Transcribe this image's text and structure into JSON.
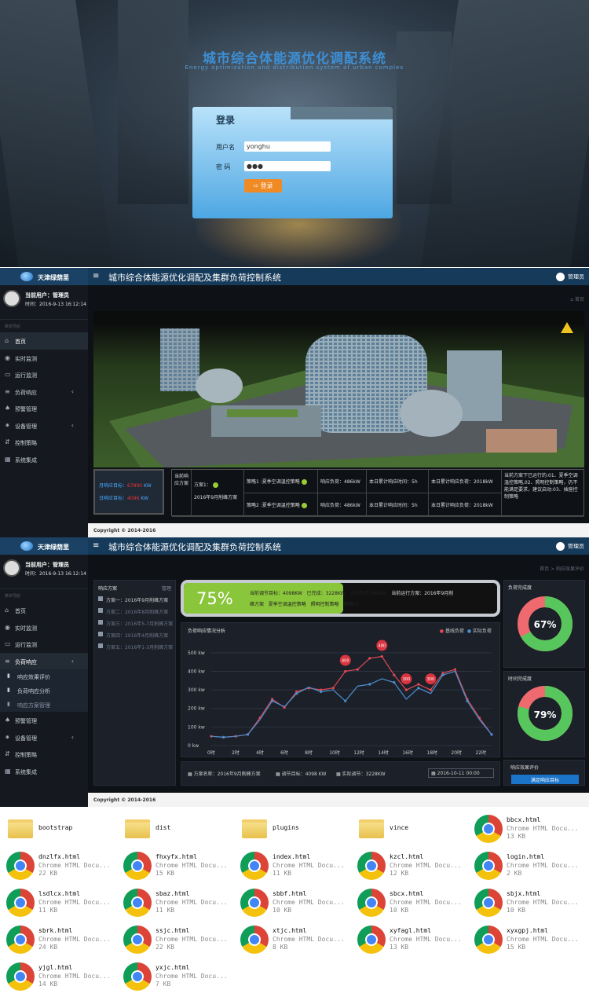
{
  "login": {
    "title": "城市综合体能源优化调配系统",
    "subtitle": "Energy optimization and distribution system of urban complex",
    "box_title": "登录",
    "username_label": "用户名",
    "username_value": "yonghu",
    "password_label": "密  码",
    "password_value": "●●●",
    "button": "登录"
  },
  "header": {
    "brand": "天津绿荫里",
    "menu_icon": "menu-icon",
    "title": "城市综合体能源优化调配及集群负荷控制系统",
    "admin": "管理员"
  },
  "user": {
    "name": "当前用户：管理员",
    "time": "时间：2016-9-13 16:12:14",
    "nav_tip": "菜单导航"
  },
  "nav1": [
    {
      "label": "首页",
      "icon": "home-icon",
      "chev": ""
    },
    {
      "label": "实时监测",
      "icon": "eye-icon",
      "chev": ""
    },
    {
      "label": "运行监测",
      "icon": "monitor-icon",
      "chev": ""
    },
    {
      "label": "负荷响应",
      "icon": "sliders-icon",
      "chev": "‹"
    },
    {
      "label": "预警管理",
      "icon": "bell-icon",
      "chev": ""
    },
    {
      "label": "设备管理",
      "icon": "gear-icon",
      "chev": "‹"
    },
    {
      "label": "控制策略",
      "icon": "control-icon",
      "chev": ""
    },
    {
      "label": "系统集成",
      "icon": "map-icon",
      "chev": ""
    }
  ],
  "nav2_top": [
    {
      "label": "首页"
    },
    {
      "label": "实时监测"
    },
    {
      "label": "运行监测"
    },
    {
      "label": "负荷响应",
      "chev": "‹"
    }
  ],
  "nav2_sub": [
    "响应效果评价",
    "负荷响应分析",
    "响应方案管理"
  ],
  "nav2_bottom": [
    {
      "label": "预警管理"
    },
    {
      "label": "设备管理",
      "chev": "‹"
    },
    {
      "label": "控制策略"
    },
    {
      "label": "系统集成"
    }
  ],
  "dash1": {
    "crumb": "首页",
    "target_month_label": "月响应目标：",
    "target_month_value": "67890",
    "target_month_unit": "KW",
    "target_day_label": "日响应目标：",
    "target_day_value": "4096",
    "target_day_unit": "KW",
    "vertical_label": "当前响应方案",
    "plan_label": "方案1：",
    "plan_name": "2016年9月削峰方案",
    "row1": [
      "策略1 :夏季空调温控策略",
      "响应负荷：486kW",
      "本日累计响应时间：5h",
      "本日累计响应负荷：2018kW"
    ],
    "row2": [
      "策略2 :夏季空调温控策略",
      "响应负荷：486kW",
      "本日累计响应时间：5h",
      "本日累计响应负荷：2018kW"
    ],
    "note": "当前方案下已运行的:01、夏季空调温控策略,02、照明控制策略，仍不能满足要求，建议启动:03、插座控制策略",
    "warning_icon": "warning-icon"
  },
  "copyright": "Copyright © 2014-2016",
  "dash2": {
    "crumb": "首页 > 响应效果评价",
    "plan_panel_title": "响应方案",
    "plan_panel_manage": "管理",
    "plans": [
      "方案一：2016年9月削峰方案",
      "方案二：2016年8月削峰方案",
      "方案三：2016年5-7月削峰方案",
      "方案四：2016年4月削峰方案",
      "方案五：2016年1-3月削峰方案"
    ],
    "progress_pct": "75%",
    "progress_value": 0.75,
    "progress_line1": [
      "当前调节目标：4098KW",
      "已完成：3228KW",
      "当前负荷:360KW",
      "当前运行方案：2016年9月削"
    ],
    "progress_line2": [
      "峰方案",
      "夏季空调温控策略",
      "照明控制策略",
      "策略03"
    ],
    "chart_title": "负荷响应情况分析",
    "legend": [
      "基线负荷",
      "实际负荷"
    ],
    "bottom_plan": "方案名称：2016年9月削峰方案",
    "bottom_target": "调节目标：4098 KW",
    "bottom_actual": "实际调节：3228KW",
    "date_value": "2016-10-11 00:00",
    "donut1_title": "负荷完成度",
    "donut1_pct": "67%",
    "donut1_value": 0.67,
    "donut2_title": "时间完成度",
    "donut2_pct": "79%",
    "donut2_value": 0.79,
    "eval_title": "响应效果评价",
    "eval_button": "满足响应目标",
    "colors": {
      "baseline": "#e04a55",
      "actual": "#4a8fd0",
      "donut_done": "#57c75d",
      "donut_rest": "#ee6a6e",
      "progress": "#8ac63b"
    }
  },
  "chart_data": {
    "type": "line",
    "title": "负荷响应情况分析",
    "xlabel": "",
    "ylabel": "",
    "categories": [
      "0时",
      "1时",
      "2时",
      "3时",
      "4时",
      "5时",
      "6时",
      "7时",
      "8时",
      "9时",
      "10时",
      "11时",
      "12时",
      "13时",
      "14时",
      "15时",
      "16时",
      "17时",
      "18时",
      "19时",
      "20时",
      "21时",
      "22时",
      "23时"
    ],
    "tick_labels": [
      "0时",
      "2时",
      "4时",
      "6时",
      "8时",
      "10时",
      "12时",
      "14时",
      "16时",
      "18时",
      "20时",
      "22时"
    ],
    "y_ticks": [
      "0 kw",
      "100 kw",
      "200 kw",
      "300 kw",
      "400 kw",
      "500 kw"
    ],
    "ylim": [
      0,
      550
    ],
    "series": [
      {
        "name": "基线负荷",
        "values": [
          50,
          45,
          50,
          60,
          150,
          250,
          205,
          290,
          310,
          300,
          310,
          400,
          410,
          470,
          480,
          380,
          300,
          330,
          300,
          390,
          410,
          250,
          150,
          60
        ]
      },
      {
        "name": "实际负荷",
        "values": [
          50,
          45,
          50,
          60,
          140,
          240,
          210,
          280,
          315,
          290,
          300,
          240,
          320,
          330,
          360,
          340,
          250,
          310,
          280,
          380,
          400,
          240,
          140,
          60
        ]
      }
    ],
    "annotations": [
      {
        "x": "11时",
        "label": "400"
      },
      {
        "x": "14时",
        "label": "480"
      },
      {
        "x": "16时",
        "label": "300"
      },
      {
        "x": "18时",
        "label": "300"
      }
    ],
    "legend_position": "top-right",
    "grid": true
  },
  "files": [
    {
      "name": "bootstrap",
      "type": "folder",
      "kind": "",
      "size": ""
    },
    {
      "name": "dist",
      "type": "folder",
      "kind": "",
      "size": ""
    },
    {
      "name": "plugins",
      "type": "folder",
      "kind": "",
      "size": ""
    },
    {
      "name": "vince",
      "type": "folder",
      "kind": "",
      "size": ""
    },
    {
      "name": "bbcx.html",
      "type": "html",
      "kind": "Chrome HTML Docu...",
      "size": "13 KB"
    },
    {
      "name": "dnzlfx.html",
      "type": "html",
      "kind": "Chrome HTML Docu...",
      "size": "22 KB"
    },
    {
      "name": "fhxyfx.html",
      "type": "html",
      "kind": "Chrome HTML Docu...",
      "size": "15 KB"
    },
    {
      "name": "index.html",
      "type": "html",
      "kind": "Chrome HTML Docu...",
      "size": "11 KB"
    },
    {
      "name": "kzcl.html",
      "type": "html",
      "kind": "Chrome HTML Docu...",
      "size": "12 KB"
    },
    {
      "name": "login.html",
      "type": "html",
      "kind": "Chrome HTML Docu...",
      "size": "2 KB"
    },
    {
      "name": "lsdlcx.html",
      "type": "html",
      "kind": "Chrome HTML Docu...",
      "size": "11 KB"
    },
    {
      "name": "sbaz.html",
      "type": "html",
      "kind": "Chrome HTML Docu...",
      "size": "11 KB"
    },
    {
      "name": "sbbf.html",
      "type": "html",
      "kind": "Chrome HTML Docu...",
      "size": "10 KB"
    },
    {
      "name": "sbcx.html",
      "type": "html",
      "kind": "Chrome HTML Docu...",
      "size": "10 KB"
    },
    {
      "name": "sbjx.html",
      "type": "html",
      "kind": "Chrome HTML Docu...",
      "size": "10 KB"
    },
    {
      "name": "sbrk.html",
      "type": "html",
      "kind": "Chrome HTML Docu...",
      "size": "24 KB"
    },
    {
      "name": "ssjc.html",
      "type": "html",
      "kind": "Chrome HTML Docu...",
      "size": "22 KB"
    },
    {
      "name": "xtjc.html",
      "type": "html",
      "kind": "Chrome HTML Docu...",
      "size": "8 KB"
    },
    {
      "name": "xyfagl.html",
      "type": "html",
      "kind": "Chrome HTML Docu...",
      "size": "13 KB"
    },
    {
      "name": "xyxgpj.html",
      "type": "html",
      "kind": "Chrome HTML Docu...",
      "size": "15 KB"
    },
    {
      "name": "yjgl.html",
      "type": "html",
      "kind": "Chrome HTML Docu...",
      "size": "14 KB"
    },
    {
      "name": "yxjc.html",
      "type": "html",
      "kind": "Chrome HTML Docu...",
      "size": "7 KB"
    }
  ]
}
